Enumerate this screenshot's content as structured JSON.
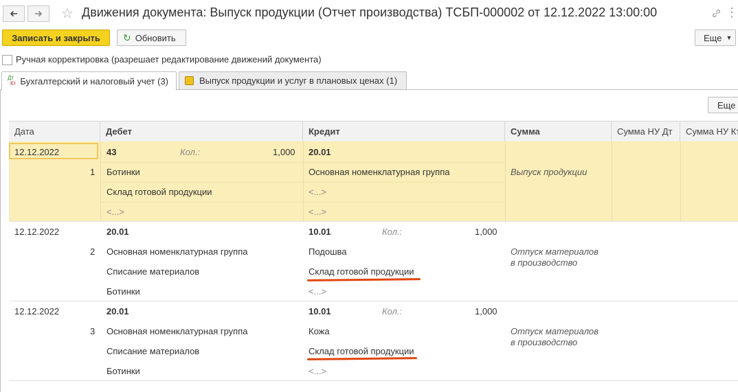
{
  "window": {
    "title": "Движения документа: Выпуск продукции (Отчет производства) ТСБП-000002 от 12.12.2022 13:00:00"
  },
  "toolbar": {
    "save_close": "Записать и закрыть",
    "refresh": "Обновить",
    "more": "Еще"
  },
  "manual_edit": {
    "label": "Ручная корректировка (разрешает редактирование движений документа)",
    "checked": false
  },
  "tabs": [
    {
      "label": "Бухгалтерский и налоговый учет (3)",
      "icon": "dt-kt-icon",
      "active": true
    },
    {
      "label": "Выпуск продукции и услуг в плановых ценах (1)",
      "icon": "register-icon",
      "active": false
    }
  ],
  "table_toolbar": {
    "more": "Еще"
  },
  "columns": [
    "Дата",
    "Дебет",
    "Кредит",
    "Сумма",
    "Сумма НУ Дт",
    "Сумма НУ Кт"
  ],
  "rows": [
    {
      "date": "12.12.2022",
      "num": "1",
      "debit_account": "43",
      "debit_qty_label": "Кол.:",
      "debit_qty": "1,000",
      "debit_sub1": "Ботинки",
      "debit_sub2": "Склад готовой продукции",
      "debit_sub3": "<...>",
      "credit_account": "20.01",
      "credit_qty_label": "",
      "credit_qty": "",
      "credit_sub1": "Основная номенклатурная группа",
      "credit_sub2": "<...>",
      "credit_sub3": "<...>",
      "content": "Выпуск продукции",
      "content2": ""
    },
    {
      "date": "12.12.2022",
      "num": "2",
      "debit_account": "20.01",
      "debit_qty_label": "",
      "debit_qty": "",
      "debit_sub1": "Основная номенклатурная группа",
      "debit_sub2": "Списание материалов",
      "debit_sub3": "Ботинки",
      "credit_account": "10.01",
      "credit_qty_label": "Кол.:",
      "credit_qty": "1,000",
      "credit_sub1": "Подошва",
      "credit_sub2": "Склад готовой продукции",
      "credit_sub3": "<...>",
      "content": "Отпуск материалов",
      "content2": "в производство"
    },
    {
      "date": "12.12.2022",
      "num": "3",
      "debit_account": "20.01",
      "debit_qty_label": "",
      "debit_qty": "",
      "debit_sub1": "Основная номенклатурная группа",
      "debit_sub2": "Списание материалов",
      "debit_sub3": "Ботинки",
      "credit_account": "10.01",
      "credit_qty_label": "Кол.:",
      "credit_qty": "1,000",
      "credit_sub1": "Кожа",
      "credit_sub2": "Склад готовой продукции",
      "credit_sub3": "<...>",
      "content": "Отпуск материалов",
      "content2": "в производство"
    }
  ],
  "colors": {
    "accent": "#f5d21f",
    "selected_row": "#fbeeb8",
    "annotation": "#e0460f"
  }
}
